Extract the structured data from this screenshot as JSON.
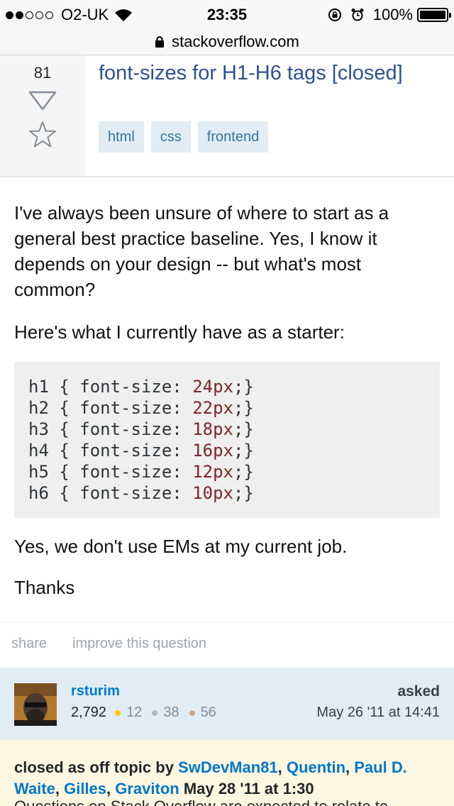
{
  "status_bar": {
    "carrier": "O2-UK",
    "time": "23:35",
    "battery": "100%"
  },
  "url_bar": {
    "domain": "stackoverflow.com"
  },
  "question": {
    "votes": "81",
    "title": "font-sizes for H1-H6 tags [closed]",
    "tags": [
      "html",
      "css",
      "frontend"
    ],
    "body": {
      "p1": "I've always been unsure of where to start as a general best practice baseline. Yes, I know it depends on your design -- but what's most common?",
      "p2": "Here's what I currently have as a starter:",
      "code_lines": [
        {
          "sel": "h1 { font-size: ",
          "num": "24px",
          "end": ";}"
        },
        {
          "sel": "h2 { font-size: ",
          "num": "22px",
          "end": ";}"
        },
        {
          "sel": "h3 { font-size: ",
          "num": "18px",
          "end": ";}"
        },
        {
          "sel": "h4 { font-size: ",
          "num": "16px",
          "end": ";}"
        },
        {
          "sel": "h5 { font-size: ",
          "num": "12px",
          "end": ";}"
        },
        {
          "sel": "h6 { font-size: ",
          "num": "10px",
          "end": ";}"
        }
      ],
      "p3": "Yes, we don't use EMs at my current job.",
      "p4": "Thanks"
    },
    "menu": {
      "share": "share",
      "improve": "improve this question"
    }
  },
  "user": {
    "name": "rsturim",
    "reputation": "2,792",
    "gold": "12",
    "silver": "38",
    "bronze": "56",
    "asked_label": "asked",
    "asked_time": "May 26 '11 at 14:41"
  },
  "closed_notice": {
    "prefix": "closed as off topic by ",
    "users": [
      "SwDevMan81",
      "Quentin",
      "Paul D. Waite",
      "Gilles",
      "Graviton"
    ],
    "date": "May 28 '11 at 1:30",
    "next_line_partial": "Questions on Stack Overflow are expected to relate to"
  },
  "colors": {
    "link": "#0077cc",
    "title": "#2d5290",
    "tag_bg": "#e1ecf4",
    "tag_text": "#39739d",
    "gold": "#ffcc01",
    "silver": "#b4b8bc",
    "bronze": "#d1a684"
  }
}
